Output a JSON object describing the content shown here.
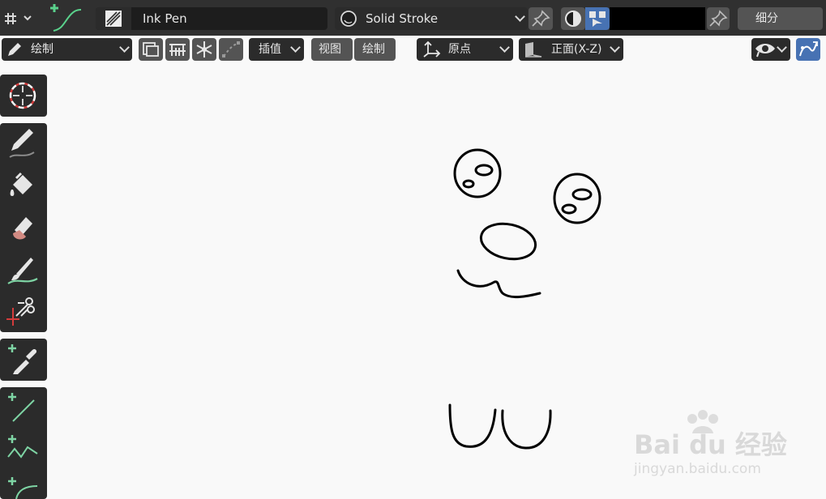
{
  "header": {
    "brush_name": "Ink Pen",
    "material_name": "Solid Stroke",
    "color_hex": "#000000",
    "subdivide_label": "细分"
  },
  "toolbar": {
    "mode_label": "绘制",
    "interpolate_label": "插值",
    "view_label": "视图",
    "draw_label": "绘制",
    "origin_label": "原点",
    "plane_label": "正面(X-Z)"
  },
  "tools": [
    {
      "name": "cursor"
    },
    {
      "name": "draw"
    },
    {
      "name": "fill"
    },
    {
      "name": "erase"
    },
    {
      "name": "tint"
    },
    {
      "name": "cutter"
    },
    {
      "name": "eyedropper"
    },
    {
      "name": "line"
    },
    {
      "name": "polyline"
    },
    {
      "name": "arc"
    }
  ],
  "colors": {
    "header_bg": "#303030",
    "field_bg": "#1d1d1d",
    "button_bg": "#545454",
    "accent_blue": "#4772b3",
    "canvas_bg": "#f9f9f9",
    "stroke": "#000000"
  },
  "watermark": {
    "brand": "Bai du 经验",
    "url": "jingyan.baidu.com"
  }
}
